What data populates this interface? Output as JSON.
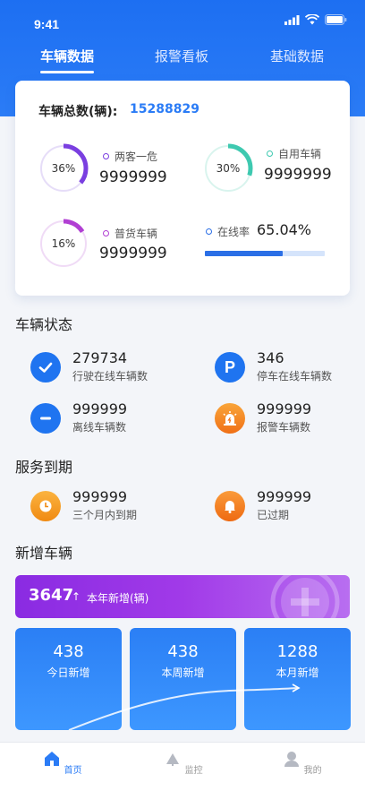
{
  "status_bar": {
    "time": "9:41"
  },
  "tabs": [
    {
      "label": "车辆数据",
      "active": true
    },
    {
      "label": "报警看板",
      "active": false
    },
    {
      "label": "基础数据",
      "active": false
    }
  ],
  "summary": {
    "total_label": "车辆总数(辆):",
    "total_value": "15288829",
    "stats": [
      {
        "label": "两客一危",
        "value": "9999999",
        "pct_text": "36%",
        "pct": 0.36,
        "color": "#7a3fe0",
        "track": "#e6ddf8"
      },
      {
        "label": "自用车辆",
        "value": "9999999",
        "pct_text": "30%",
        "pct": 0.3,
        "color": "#3ec9b0",
        "track": "#d9f4ee"
      },
      {
        "label": "普货车辆",
        "value": "9999999",
        "pct_text": "16%",
        "pct": 0.16,
        "color": "#b13fd3",
        "track": "#f0dbf6"
      }
    ],
    "online": {
      "label": "在线率",
      "value": "65.04%",
      "fraction": 0.6504,
      "color": "#2b6fe6"
    }
  },
  "vehicle_status": {
    "title": "车辆状态",
    "items": [
      {
        "value": "279734",
        "label": "行驶在线车辆数",
        "icon": "check-icon",
        "color": "#1f74f0"
      },
      {
        "value": "346",
        "label": "停车在线车辆数",
        "icon": "parking-icon",
        "color": "#1f74f0"
      },
      {
        "value": "999999",
        "label": "离线车辆数",
        "icon": "minus-icon",
        "color": "#1f74f0"
      },
      {
        "value": "999999",
        "label": "报警车辆数",
        "icon": "alarm-icon",
        "color": "#f37b1d"
      }
    ]
  },
  "service_expiry": {
    "title": "服务到期",
    "items": [
      {
        "value": "999999",
        "label": "三个月内到期",
        "icon": "clock-icon",
        "color": "#f59a1b"
      },
      {
        "value": "999999",
        "label": "已过期",
        "icon": "bell-icon",
        "color": "#f37b1d"
      }
    ]
  },
  "new_vehicles": {
    "title": "新增车辆",
    "year": {
      "value": "3647",
      "arrow": "↑",
      "label": "本年新增(辆)"
    },
    "cards": [
      {
        "value": "438",
        "label": "今日新增"
      },
      {
        "value": "438",
        "label": "本周新增"
      },
      {
        "value": "1288",
        "label": "本月新增"
      }
    ]
  },
  "bottom_nav": [
    {
      "label": "首页",
      "icon": "home-icon",
      "active": true
    },
    {
      "label": "监控",
      "icon": "monitor-icon",
      "active": false
    },
    {
      "label": "我的",
      "icon": "profile-icon",
      "active": false
    }
  ],
  "colors": {
    "primary": "#2b7cf6",
    "purple": "#9b34e6"
  }
}
